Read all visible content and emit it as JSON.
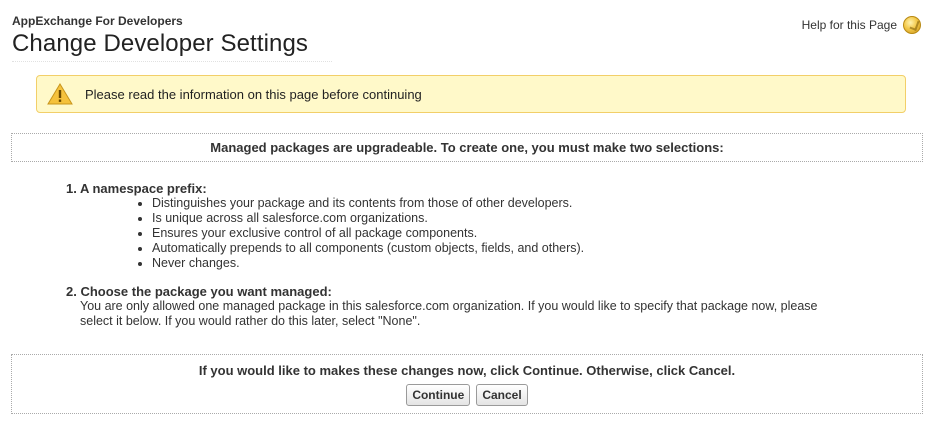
{
  "header": {
    "subtitle": "AppExchange For Developers",
    "title": "Change Developer Settings",
    "help_label": "Help for this Page"
  },
  "warning": {
    "text": "Please read the information on this page before continuing"
  },
  "intro": {
    "text": "Managed packages are upgradeable. To create one, you must make two selections:"
  },
  "items": [
    {
      "heading": "1. A namespace prefix:",
      "bullets": [
        "Distinguishes your package and its contents from those of other developers.",
        "Is unique across all salesforce.com organizations.",
        "Ensures your exclusive control of all package components.",
        "Automatically prepends to all components (custom objects, fields, and others).",
        "Never changes."
      ]
    },
    {
      "heading": "2. Choose the package you want managed:",
      "body_line1": "You are only allowed one managed package in this salesforce.com organization. If you would like to specify that package now, please",
      "body_line2": "select it below. If you would rather do this later, select \"None\"."
    }
  ],
  "footer": {
    "text": "If you would like to makes these changes now, click Continue. Otherwise, click Cancel.",
    "continue_label": "Continue",
    "cancel_label": "Cancel"
  },
  "colors": {
    "warning_bg": "#fff9c9",
    "warning_border": "#f2cf69",
    "warning_icon": "#f5c23d"
  }
}
